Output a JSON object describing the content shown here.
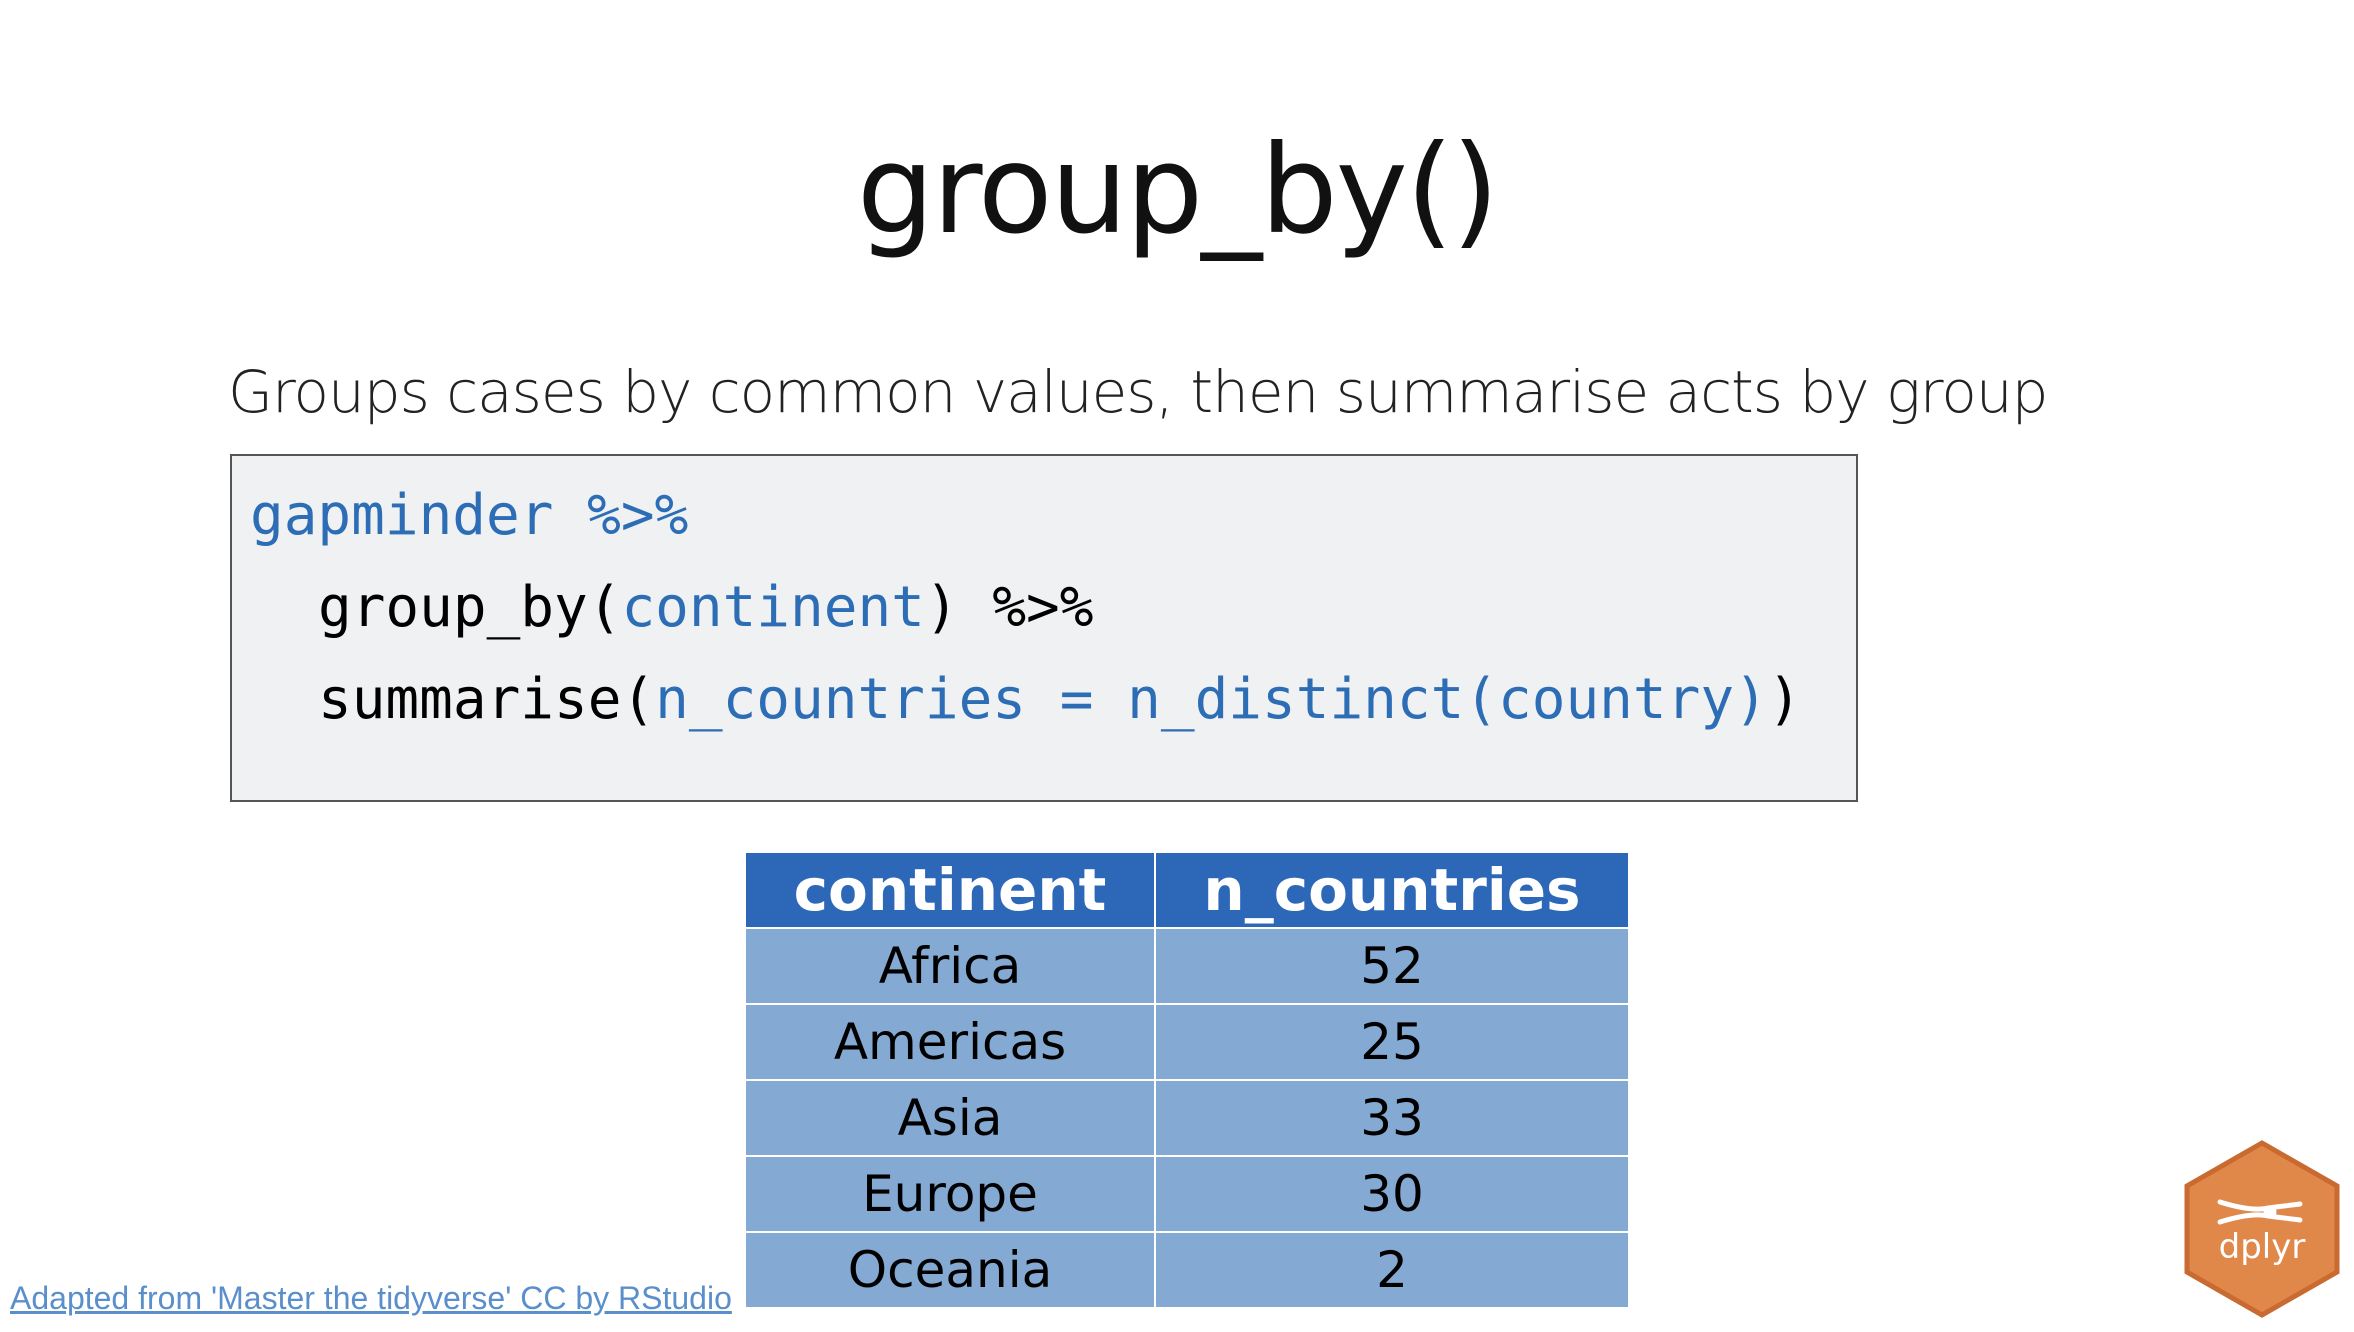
{
  "slide": {
    "title": "group_by()",
    "subtitle": "Groups cases by common values, then summarise acts by group"
  },
  "code": {
    "line1": {
      "obj": "gapminder",
      "pipe": "%>%"
    },
    "line2": {
      "fn": "group_by(",
      "arg": "continent",
      "close": ")",
      "pipe": "%>%"
    },
    "line3": {
      "fn": "summarise(",
      "arg": "n_countries = n_distinct(country)",
      "close": ")"
    },
    "colors": {
      "blue": "#2c6db5",
      "black": "#000000",
      "background": "#f0f1f2"
    }
  },
  "table": {
    "headers": [
      "continent",
      "n_countries"
    ],
    "rows": [
      [
        "Africa",
        "52"
      ],
      [
        "Americas",
        "25"
      ],
      [
        "Asia",
        "33"
      ],
      [
        "Europe",
        "30"
      ],
      [
        "Oceania",
        "2"
      ]
    ],
    "header_color": "#2d67b8",
    "cell_color": "#84a9d3"
  },
  "footer": {
    "credit": "Adapted from 'Master the tidyverse' CC by RStudio"
  },
  "logo": {
    "text": "dplyr",
    "icon": "pliers-icon",
    "color": "#e0874a"
  }
}
